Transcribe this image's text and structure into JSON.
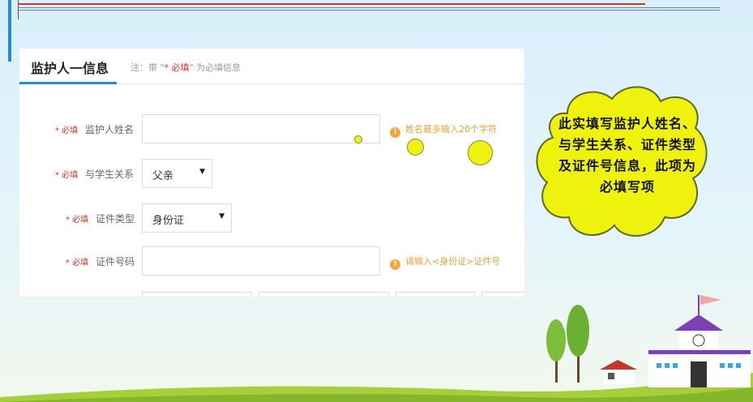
{
  "form": {
    "title": "监护人一信息",
    "note_prefix": "注：带 \"",
    "note_required": "* 必填",
    "note_suffix": "\" 为必填信息",
    "required_mark": "* 必填",
    "fields": [
      {
        "label": "监护人姓名",
        "value": "",
        "hint": "姓名最多输入20个字符"
      },
      {
        "label": "与学生关系",
        "value": "父亲"
      },
      {
        "label": "证件类型",
        "value": "身份证"
      },
      {
        "label": "证件号码",
        "value": "",
        "hint": "请输入<身份证>证件号"
      }
    ],
    "hint_icon": "!"
  },
  "callout": {
    "text": "此实填写监护人姓名、与学生关系、证件类型及证件号信息，此项为必填写项"
  },
  "colors": {
    "accent": "#1f8fd6",
    "required": "#d9322b",
    "hint": "#e7a23c",
    "cloud": "#eef20d"
  },
  "icons": {
    "select_arrow": "▼"
  }
}
